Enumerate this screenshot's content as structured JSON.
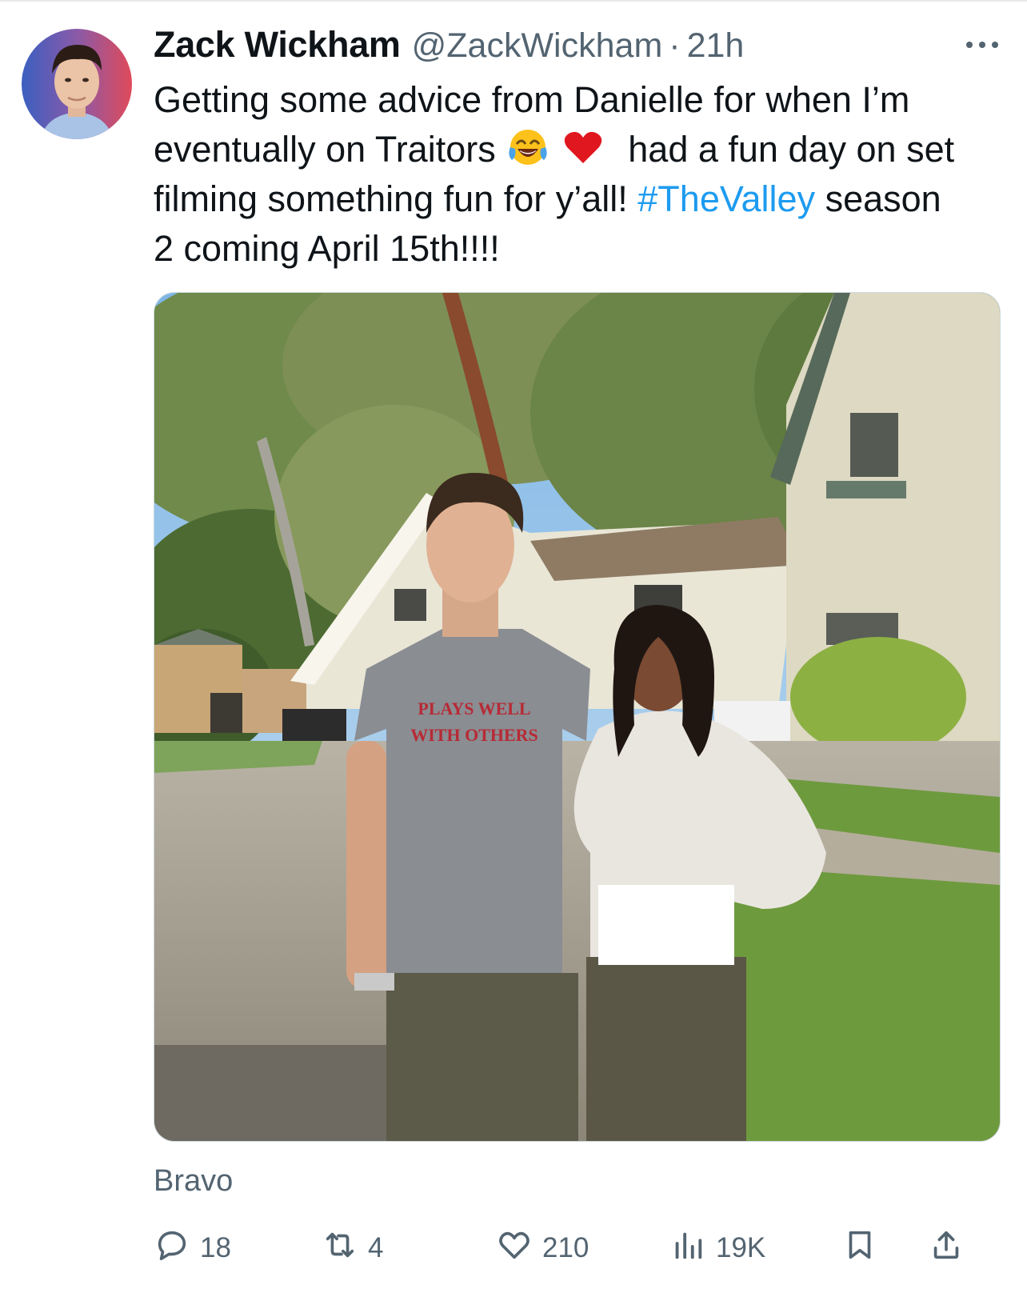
{
  "tweet": {
    "author_name": "Zack Wickham",
    "author_handle": "@ZackWickham",
    "separator": "·",
    "timestamp": "21h",
    "more_icon": "more-horizontal-icon",
    "text_lines": [
      "Getting some advice from Danielle for when I’m",
      "eventually on Traitors",
      "had a fun day on set",
      "filming something fun for y’all!",
      "#TheValley",
      "season",
      "2 coming April 15th!!!!"
    ],
    "emojis": [
      "face-with-tears-of-joy-emoji",
      "red-heart-emoji"
    ],
    "photo": {
      "description_icon": "photo-image",
      "shirt_text_line1": "PLAYS WELL",
      "shirt_text_line2": "WITH OTHERS"
    },
    "source_label": "Bravo",
    "actions": {
      "reply": {
        "icon": "reply-icon",
        "count": "18"
      },
      "retweet": {
        "icon": "retweet-icon",
        "count": "4"
      },
      "like": {
        "icon": "heart-icon",
        "count": "210"
      },
      "views": {
        "icon": "views-icon",
        "count": "19K"
      },
      "bookmark": {
        "icon": "bookmark-icon"
      },
      "share": {
        "icon": "share-icon"
      }
    }
  },
  "colors": {
    "text": "#0f1419",
    "secondary": "#536471",
    "link": "#1d9bf0",
    "border": "#cfd9de"
  }
}
